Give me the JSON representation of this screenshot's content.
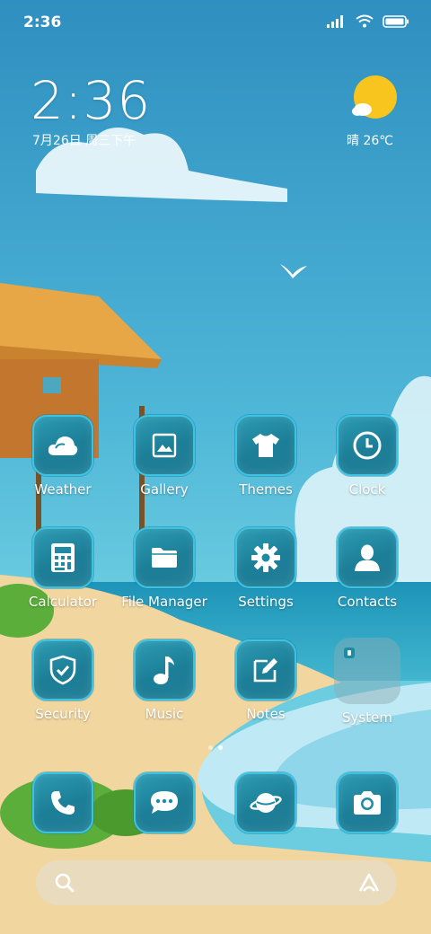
{
  "status_bar": {
    "time": "2:36"
  },
  "clock_widget": {
    "time": "2:36",
    "date": "7月26日 周三下午"
  },
  "weather_widget": {
    "text": "晴 26℃"
  },
  "apps": [
    {
      "label": "Weather",
      "icon": "weather-icon"
    },
    {
      "label": "Gallery",
      "icon": "gallery-icon"
    },
    {
      "label": "Themes",
      "icon": "themes-icon"
    },
    {
      "label": "Clock",
      "icon": "clock-icon"
    },
    {
      "label": "Calculator",
      "icon": "calculator-icon"
    },
    {
      "label": "File Manager",
      "icon": "folder-icon"
    },
    {
      "label": "Settings",
      "icon": "gear-icon"
    },
    {
      "label": "Contacts",
      "icon": "contact-icon"
    },
    {
      "label": "Security",
      "icon": "shield-icon"
    },
    {
      "label": "Music",
      "icon": "music-note-icon"
    },
    {
      "label": "Notes",
      "icon": "notes-icon"
    },
    {
      "label": "System",
      "icon": "folder-icon"
    }
  ],
  "dock": [
    {
      "icon": "phone-icon"
    },
    {
      "icon": "message-icon"
    },
    {
      "icon": "browser-icon"
    },
    {
      "icon": "camera-icon"
    }
  ],
  "page_indicator": {
    "pages": 2,
    "current": 2
  },
  "colors": {
    "tile": "#1f8aa3",
    "tile_border": "#3bc3e4",
    "sky": "#3aa6cf",
    "sand": "#f2d6a0"
  }
}
